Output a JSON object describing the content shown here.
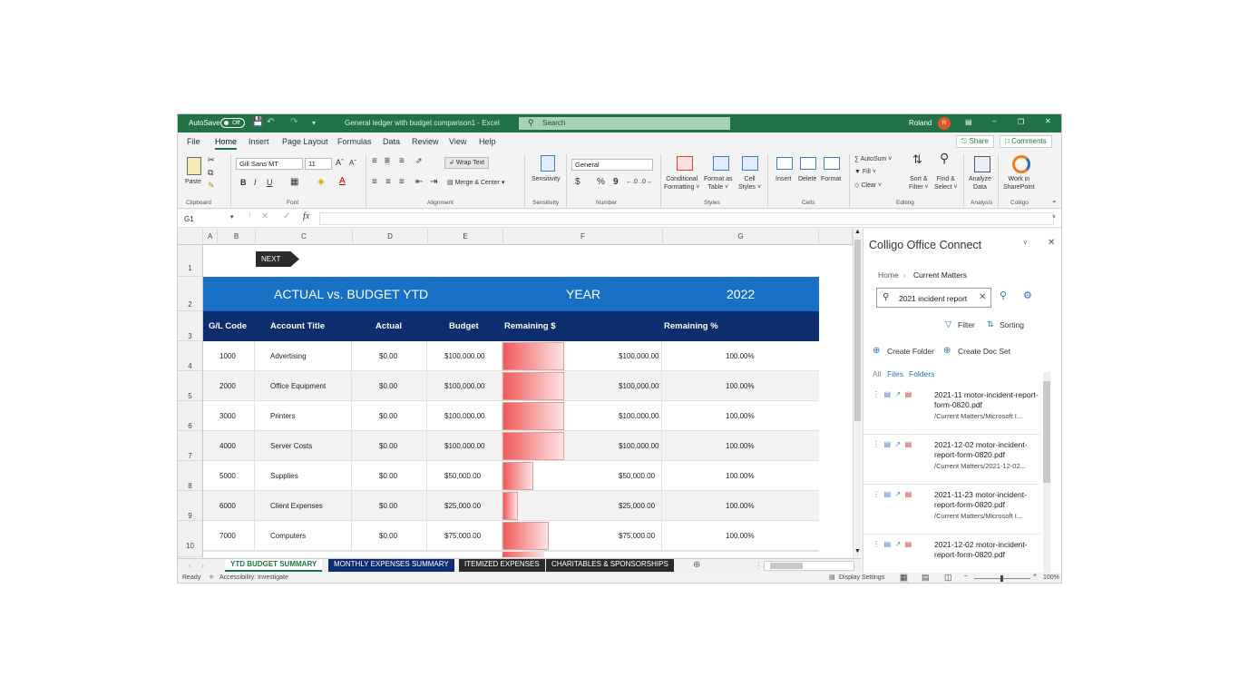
{
  "titlebar": {
    "autosave_label": "AutoSave",
    "autosave_state": "Off",
    "doc_title": "General ledger with budget comparison1 - Excel",
    "search_placeholder": "Search",
    "user_name": "Roland",
    "user_initial": "R"
  },
  "menu": {
    "tabs": [
      "File",
      "Home",
      "Insert",
      "Page Layout",
      "Formulas",
      "Data",
      "Review",
      "View",
      "Help"
    ],
    "active": "Home",
    "share_label": "Share",
    "comments_label": "Comments"
  },
  "ribbon": {
    "clipboard": {
      "paste": "Paste",
      "group": "Clipboard"
    },
    "font": {
      "family": "Gill Sans MT",
      "size": "11",
      "bold": "B",
      "italic": "I",
      "underline": "U",
      "grow": "Aˆ",
      "shrink": "Aˇ",
      "group": "Font"
    },
    "alignment": {
      "wrap": "Wrap Text",
      "merge": "Merge & Center",
      "group": "Alignment"
    },
    "sensitivity": {
      "label": "Sensitivity",
      "group": "Sensitivity"
    },
    "number": {
      "format": "General",
      "currency": "$",
      "percent": "%",
      "comma": "9",
      "group": "Number"
    },
    "styles": {
      "conditional": "Conditional\nFormatting",
      "format_table": "Format as\nTable",
      "cell_styles": "Cell\nStyles",
      "group": "Styles"
    },
    "cells": {
      "insert": "Insert",
      "delete": "Delete",
      "format": "Format",
      "group": "Cells"
    },
    "editing": {
      "autosum": "AutoSum",
      "fill": "Fill",
      "clear": "Clear",
      "sort": "Sort &\nFilter",
      "find": "Find &\nSelect",
      "group": "Editing"
    },
    "analysis": {
      "analyze": "Analyze\nData",
      "group": "Analysis"
    },
    "colligo": {
      "work": "Work in\nSharePoint",
      "group": "Colligo"
    }
  },
  "formula_bar": {
    "name_box": "G1",
    "fx": "fx",
    "value": ""
  },
  "columns": [
    "A",
    "B",
    "C",
    "D",
    "E",
    "F",
    "G"
  ],
  "rows": [
    "1",
    "2",
    "3",
    "4",
    "5",
    "6",
    "7",
    "8",
    "9",
    "10"
  ],
  "sheet": {
    "next_button": "NEXT",
    "banner_title": "ACTUAL vs. BUDGET YTD",
    "year_label": "YEAR",
    "year_value": "2022",
    "headers": [
      "G/L Code",
      "Account Title",
      "Actual",
      "Budget",
      "Remaining $",
      "Remaining %"
    ],
    "data": [
      {
        "code": "1000",
        "title": "Advertising",
        "actual": "$0.00",
        "budget": "$100,000.00",
        "remaining": "$100,000.00",
        "pct": "100.00%",
        "bar_level": 1.0
      },
      {
        "code": "2000",
        "title": "Office Equipment",
        "actual": "$0.00",
        "budget": "$100,000.00",
        "remaining": "$100,000.00",
        "pct": "100.00%",
        "bar_level": 1.0
      },
      {
        "code": "3000",
        "title": "Printers",
        "actual": "$0.00",
        "budget": "$100,000.00",
        "remaining": "$100,000.00",
        "pct": "100.00%",
        "bar_level": 1.0
      },
      {
        "code": "4000",
        "title": "Server Costs",
        "actual": "$0.00",
        "budget": "$100,000.00",
        "remaining": "$100,000.00",
        "pct": "100.00%",
        "bar_level": 1.0
      },
      {
        "code": "5000",
        "title": "Supplies",
        "actual": "$0.00",
        "budget": "$50,000.00",
        "remaining": "$50,000.00",
        "pct": "100.00%",
        "bar_level": 0.5
      },
      {
        "code": "6000",
        "title": "Client Expenses",
        "actual": "$0.00",
        "budget": "$25,000.00",
        "remaining": "$25,000.00",
        "pct": "100.00%",
        "bar_level": 0.25
      },
      {
        "code": "7000",
        "title": "Computers",
        "actual": "$0.00",
        "budget": "$75,000.00",
        "remaining": "$75,000.00",
        "pct": "100.00%",
        "bar_level": 0.75
      }
    ]
  },
  "sheet_tabs": [
    {
      "label": "YTD BUDGET SUMMARY",
      "color": "#ffffff",
      "text": "#217346",
      "active": true
    },
    {
      "label": "MONTHLY EXPENSES SUMMARY",
      "color": "#0d2e6e",
      "text": "#ffffff"
    },
    {
      "label": "ITEMIZED EXPENSES",
      "color": "#2b2b2b",
      "text": "#ffffff"
    },
    {
      "label": "CHARITABLES & SPONSORSHIPS",
      "color": "#2b2b2b",
      "text": "#ffffff"
    }
  ],
  "status": {
    "ready": "Ready",
    "accessibility": "Accessibility: Investigate",
    "display_settings": "Display Settings",
    "zoom": "100%"
  },
  "pane": {
    "title": "Colligo Office Connect",
    "breadcrumb_home": "Home",
    "breadcrumb_current": "Current Matters",
    "search_value": "2021 incident report",
    "filter": "Filter",
    "sorting": "Sorting",
    "create_folder": "Create Folder",
    "create_docset": "Create Doc Set",
    "view_all": "All",
    "view_files": "Files",
    "view_folders": "Folders",
    "files": [
      {
        "name": "2021-11 motor-incident-report-form-0820.pdf",
        "path": "/Current Matters/Microsoft I..."
      },
      {
        "name": "2021-12-02 motor-incident-report-form-0820.pdf",
        "path": "/Current Matters/2021-12-02..."
      },
      {
        "name": "2021-11-23 motor-incident-report-form-0820.pdf",
        "path": "/Current Matters/Microsoft I..."
      },
      {
        "name": "2021-12-02 motor-incident-report-form-0820.pdf",
        "path": ""
      }
    ]
  },
  "colors": {
    "excel_green": "#217346",
    "banner_blue": "#1870c4",
    "header_navy": "#0d2e6e",
    "bar_red": "#f05a5a"
  }
}
